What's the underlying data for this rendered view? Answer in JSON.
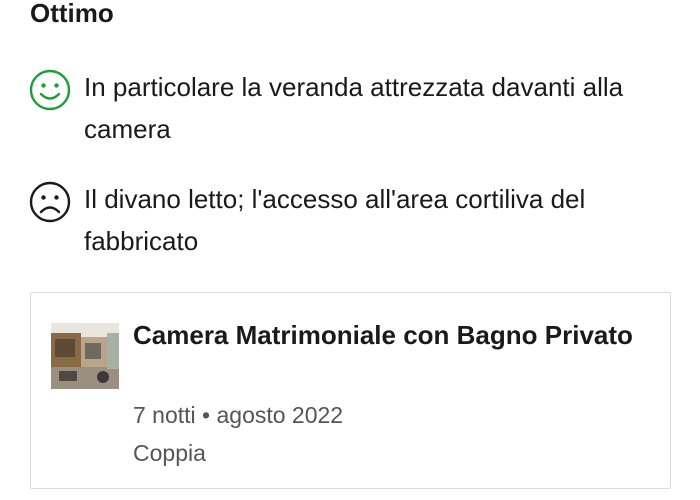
{
  "review": {
    "heading": "Ottimo",
    "positive": {
      "icon": "smiley-face-icon",
      "icon_color": "#1e9c3c",
      "text": "In particolare la veranda attrezzata davanti alla camera"
    },
    "negative": {
      "icon": "sad-face-icon",
      "icon_color": "#1a1a1a",
      "text": "Il divano letto; l'accesso all'area cortiliva del fabbricato"
    }
  },
  "stay_card": {
    "room_name": "Camera Matrimoniale con Bagno Privato",
    "stay_info": "7 notti • agosto 2022",
    "traveler_type": "Coppia"
  }
}
